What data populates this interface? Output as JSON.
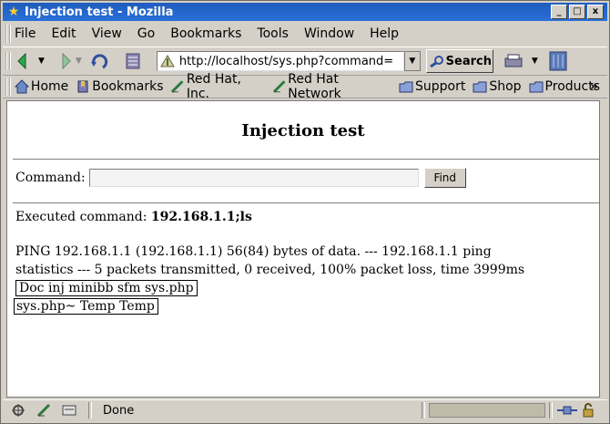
{
  "window": {
    "title": "Injection test - Mozilla",
    "minimize": "_",
    "maximize": "□",
    "close": "x"
  },
  "menu": [
    "File",
    "Edit",
    "View",
    "Go",
    "Bookmarks",
    "Tools",
    "Window",
    "Help"
  ],
  "toolbar": {
    "url": "http://localhost/sys.php?command=",
    "search_label": "Search"
  },
  "bookmarks": [
    "Home",
    "Bookmarks",
    "Red Hat, Inc.",
    "Red Hat Network",
    "Support",
    "Shop",
    "Products"
  ],
  "bookmarks_more": "»",
  "page": {
    "heading": "Injection test",
    "command_label": "Command:",
    "command_value": "",
    "find_label": "Find",
    "executed_prefix": "Executed command: ",
    "executed_command": "192.168.1.1;ls",
    "output_text": "PING 192.168.1.1 (192.168.1.1) 56(84) bytes of data. --- 192.168.1.1 ping statistics --- 5 packets transmitted, 0 received, 100% packet loss, time 3999ms",
    "output_box1": "Doc inj minibb sfm sys.php",
    "output_box2": "sys.php~ Temp Temp"
  },
  "status": {
    "text": "Done"
  }
}
